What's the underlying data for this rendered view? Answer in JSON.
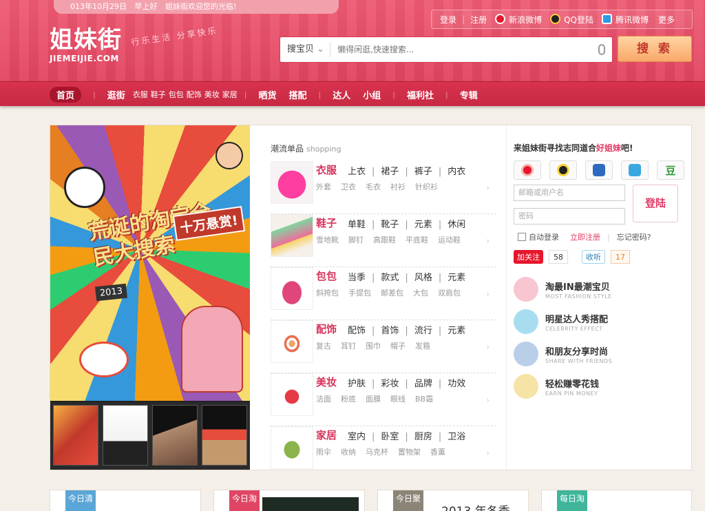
{
  "header": {
    "welcome_date": "013年10月29日",
    "welcome_greeting": "早上好",
    "welcome_text": "姐妹街欢迎您的光临!",
    "logo_cn": "姐妹街",
    "logo_en": "JIEMEIJIE.COM",
    "slogan": "行乐生活 分享快乐",
    "links": {
      "login": "登录",
      "register": "注册",
      "weibo": "新浪微博",
      "qq": "QQ登陆",
      "tencent_weibo": "腾讯微博",
      "more": "更多"
    },
    "search": {
      "scope": "搜宝贝",
      "placeholder": "懒得闲逛,快速搜索...",
      "button": "搜 索"
    }
  },
  "nav": {
    "home": "首页",
    "stroll": "逛街",
    "stroll_subs": [
      "衣服",
      "鞋子",
      "包包",
      "配饰",
      "美妆",
      "家居"
    ],
    "show": "晒货",
    "match": "搭配",
    "expert": "达人",
    "group": "小组",
    "welfare": "福利社",
    "special": "专辑"
  },
  "poster": {
    "title": "荒诞的淘宝全民大搜索",
    "reward": "十万悬赏!",
    "year": "2013"
  },
  "products": {
    "heading": "潮流单品",
    "heading_en": "shopping",
    "categories": [
      {
        "title": "衣服",
        "main": [
          "上衣",
          "裙子",
          "裤子",
          "内衣"
        ],
        "sub": [
          "外套",
          "卫衣",
          "毛衣",
          "衬衫",
          "针织衫"
        ]
      },
      {
        "title": "鞋子",
        "main": [
          "单鞋",
          "靴子",
          "元素",
          "休闲"
        ],
        "sub": [
          "雪地靴",
          "脚钉",
          "高跟鞋",
          "平底鞋",
          "运动鞋"
        ]
      },
      {
        "title": "包包",
        "main": [
          "当季",
          "款式",
          "风格",
          "元素"
        ],
        "sub": [
          "斜挎包",
          "手提包",
          "邮差包",
          "大包",
          "双肩包"
        ]
      },
      {
        "title": "配饰",
        "main": [
          "配饰",
          "首饰",
          "流行",
          "元素"
        ],
        "sub": [
          "复古",
          "耳钉",
          "围巾",
          "帽子",
          "发箍"
        ]
      },
      {
        "title": "美妆",
        "main": [
          "护肤",
          "彩妆",
          "品牌",
          "功效"
        ],
        "sub": [
          "洁面",
          "粉底",
          "面膜",
          "眼线",
          "BB霜"
        ]
      },
      {
        "title": "家居",
        "main": [
          "室内",
          "卧室",
          "厨房",
          "卫浴"
        ],
        "sub": [
          "雨伞",
          "收纳",
          "马克杯",
          "置物架",
          "香薰"
        ]
      }
    ]
  },
  "sidebar": {
    "title_prefix": "来姐妹街寻找志同道合",
    "title_highlight": "好姐妹",
    "title_suffix": "吧!",
    "email_placeholder": "邮箱或用户名",
    "password_placeholder": "密码",
    "login_button": "登陆",
    "auto_login": "自动登录",
    "register_now": "立即注册",
    "forgot": "忘记密码?",
    "weibo_follow": "加关注",
    "weibo_count": "58",
    "qq_follow": "收听",
    "qq_count": "17",
    "features": [
      {
        "title": "淘最IN最潮宝贝",
        "sub": "MOST FASHION STYLE"
      },
      {
        "title": "明星达人秀搭配",
        "sub": "CELEBRITY EFFECT"
      },
      {
        "title": "和朋友分享时尚",
        "sub": "SHARE WITH FRIENDS"
      },
      {
        "title": "轻松赚零花钱",
        "sub": "EARN PIN MONEY"
      }
    ]
  },
  "bottom": {
    "tags": [
      "今日清",
      "今日淘",
      "今日聚",
      "每日淘"
    ],
    "peek_text": "2013 年冬季"
  },
  "colors": {
    "brand_pink": "#e2445f",
    "nav_red": "#c82942",
    "accent_text": "#d6335a"
  }
}
